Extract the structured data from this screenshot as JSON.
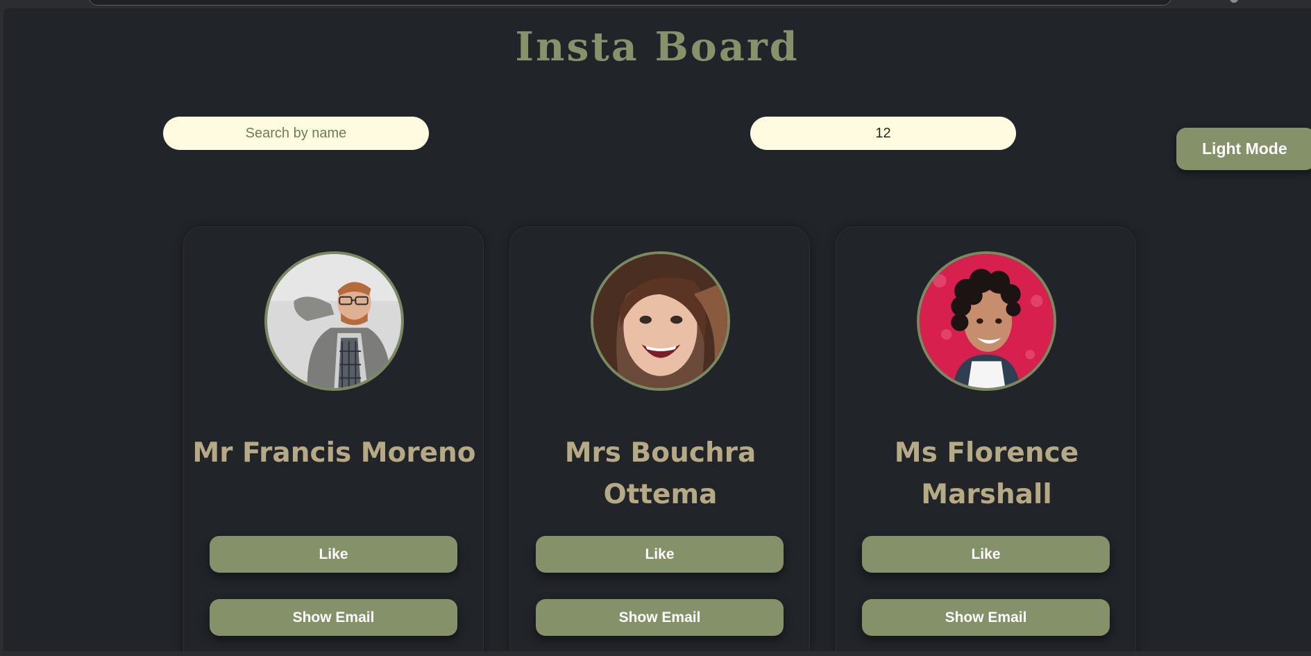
{
  "header": {
    "title": "Insta Board"
  },
  "controls": {
    "search_placeholder": "Search by name",
    "count_value": "12",
    "mode_button_label": "Light Mode"
  },
  "cards": [
    {
      "name": "Mr Francis Moreno",
      "like_label": "Like",
      "email_label": "Show Email",
      "avatar_icon": "person-photo-man-glasses"
    },
    {
      "name": "Mrs Bouchra Ottema",
      "like_label": "Like",
      "email_label": "Show Email",
      "avatar_icon": "person-photo-woman-smiling"
    },
    {
      "name": "Ms Florence Marshall",
      "like_label": "Like",
      "email_label": "Show Email",
      "avatar_icon": "person-photo-woman-curly-hair"
    }
  ],
  "colors": {
    "background": "#212429",
    "accent": "#849169",
    "title": "#86926a",
    "name_text": "#b6aa85",
    "input_bg": "#fffbe0"
  }
}
